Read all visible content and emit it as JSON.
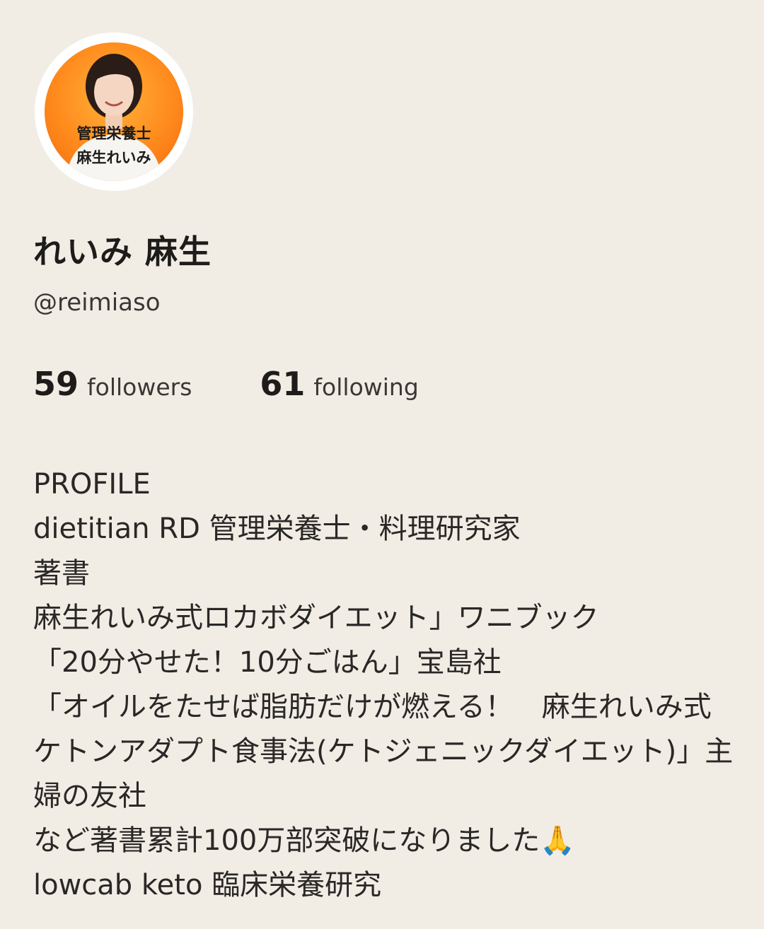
{
  "profile": {
    "avatar_caption_line1": "管理栄養士",
    "avatar_caption_line2": "麻生れいみ",
    "display_name": "れいみ 麻生",
    "handle": "@reimiaso"
  },
  "stats": {
    "followers_count": "59",
    "followers_label": "followers",
    "following_count": "61",
    "following_label": "following"
  },
  "bio": {
    "line1": "PROFILE",
    "line2": "dietitian  RD 管理栄養士・料理研究家",
    "line3": "著書",
    "line4": "麻生れいみ式ロカボダイエット」ワニブック",
    "line5": "「20分やせた！10分ごはん」宝島社",
    "line6": "「オイルをたせば脂肪だけが燃える！　麻生れいみ式ケトンアダプト食事法(ケトジェニックダイエット)」主婦の友社",
    "line7": "など著書累計100万部突破になりました🙏",
    "line8": "lowcab  keto  臨床栄養研究"
  },
  "colors": {
    "background": "#f1ede5",
    "text": "#1e1c1a",
    "avatar_orange": "#ff8a1c"
  },
  "icons": {
    "more": "more-dots-icon"
  }
}
